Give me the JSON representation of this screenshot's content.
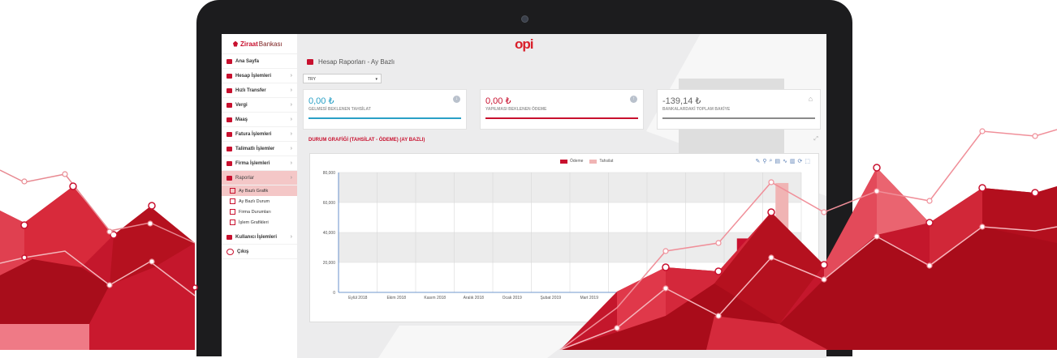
{
  "bank": {
    "name_bold": "Ziraat",
    "name_rest": "Bankası"
  },
  "sidebar": {
    "items": [
      {
        "label": "Ana Sayfa"
      },
      {
        "label": "Hesap İşlemleri",
        "chev": "›"
      },
      {
        "label": "Hızlı Transfer",
        "chev": "›"
      },
      {
        "label": "Vergi",
        "chev": "›"
      },
      {
        "label": "Maaş",
        "chev": "›"
      },
      {
        "label": "Fatura İşlemleri",
        "chev": "›"
      },
      {
        "label": "Talimatlı İşlemler",
        "chev": "›"
      },
      {
        "label": "Firma İşlemleri",
        "chev": "›"
      },
      {
        "label": "Raporlar",
        "chev": "›"
      }
    ],
    "subitems": [
      {
        "label": "Ay Bazlı Grafik"
      },
      {
        "label": "Ay Bazlı Durum"
      },
      {
        "label": "Firma Durumları"
      },
      {
        "label": "İşlem Grafikleri"
      }
    ],
    "bottom": [
      {
        "label": "Kullanıcı İşlemleri",
        "chev": "›"
      },
      {
        "label": "Çıkış"
      }
    ]
  },
  "header": {
    "logo": "opi",
    "title": "Hesap Raporları - Ay Bazlı"
  },
  "currency_select": {
    "value": "TRY",
    "caret": "▾"
  },
  "cards": [
    {
      "amount": "0,00 ₺",
      "label": "GELMESİ BEKLENEN TAHSİLAT",
      "icon": "↓",
      "color": "#2aa0c6"
    },
    {
      "amount": "0,00 ₺",
      "label": "YAPILMASI BEKLENEN ÖDEME",
      "icon": "↑",
      "color": "#c8102e"
    },
    {
      "amount": "-139,14 ₺",
      "label": "BANKALARDAKİ TOPLAM BAKİYE",
      "icon": "⌂",
      "color": "#8a8a8a"
    }
  ],
  "chart_section": {
    "title": "DURUM GRAFİĞİ (TAHSİLAT - ÖDEME) (AY BAZLI)",
    "expand": "⤢"
  },
  "toolbar_icons": [
    "✎",
    "⚲",
    "⌕",
    "▤",
    "∿",
    "▥",
    "⟳",
    "⬚"
  ],
  "chart_data": {
    "type": "bar",
    "categories": [
      "Eylül 2018",
      "Ekim 2018",
      "Kasım 2018",
      "Aralık 2018",
      "Ocak 2019",
      "Şubat 2019",
      "Mart 2019",
      "",
      "",
      "",
      "",
      ""
    ],
    "series": [
      {
        "name": "Ödeme",
        "color": "#c8102e",
        "values": [
          0,
          0,
          0,
          0,
          0,
          0,
          0,
          0,
          0,
          0,
          36000,
          0
        ]
      },
      {
        "name": "Tahsilat",
        "color": "#f0b4b4",
        "values": [
          0,
          0,
          0,
          0,
          0,
          0,
          0,
          0,
          0,
          0,
          0,
          73000
        ]
      }
    ],
    "yticks": [
      "0",
      "20,000",
      "40,000",
      "60,000",
      "80,000"
    ],
    "ylim": [
      0,
      80000
    ]
  }
}
